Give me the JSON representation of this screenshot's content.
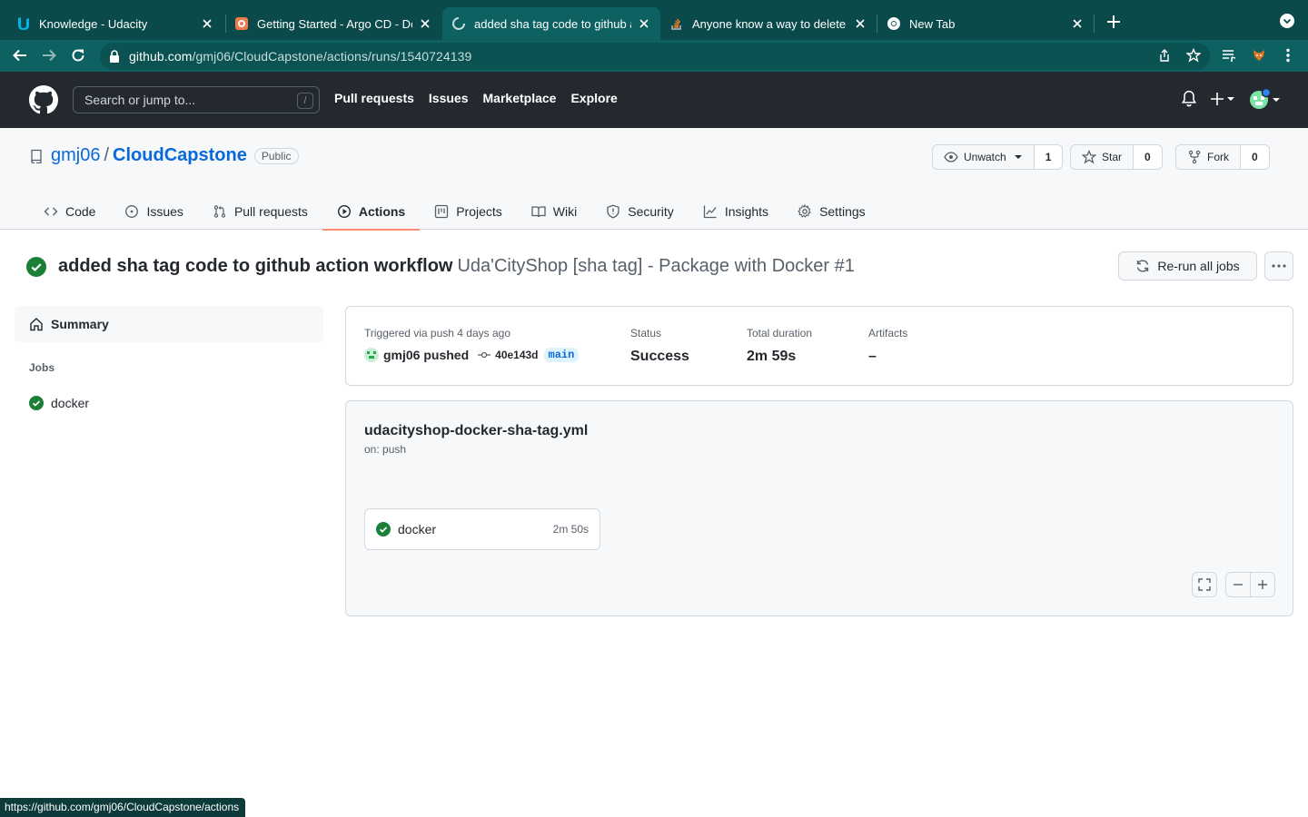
{
  "browser": {
    "tabs": [
      {
        "title": "Knowledge - Udacity",
        "favicon": "udacity-icon"
      },
      {
        "title": "Getting Started - Argo CD - Declarative GitOps CD for Kubernetes",
        "favicon": "argo-icon"
      },
      {
        "title": "added sha tag code to github action workflow",
        "favicon": "github-icon",
        "active": true
      },
      {
        "title": "Anyone know a way to delete a workflow from GitHub Actions?",
        "favicon": "stackoverflow-icon"
      },
      {
        "title": "New Tab",
        "favicon": "chrome-icon"
      }
    ],
    "url_host": "github.com",
    "url_path": "/gmj06/CloudCapstone/actions/runs/1540724139",
    "status_url": "https://github.com/gmj06/CloudCapstone/actions"
  },
  "gh_header": {
    "search_placeholder": "Search or jump to...",
    "search_shortcut": "/",
    "nav": [
      "Pull requests",
      "Issues",
      "Marketplace",
      "Explore"
    ]
  },
  "repo": {
    "owner": "gmj06",
    "separator": "/",
    "name": "CloudCapstone",
    "visibility": "Public",
    "watch_label": "Unwatch",
    "watch_count": "1",
    "star_label": "Star",
    "star_count": "0",
    "fork_label": "Fork",
    "fork_count": "0",
    "tabs": [
      {
        "label": "Code",
        "icon": "code-icon"
      },
      {
        "label": "Issues",
        "icon": "issue-icon"
      },
      {
        "label": "Pull requests",
        "icon": "pull-request-icon"
      },
      {
        "label": "Actions",
        "icon": "play-icon",
        "selected": true
      },
      {
        "label": "Projects",
        "icon": "project-icon"
      },
      {
        "label": "Wiki",
        "icon": "book-icon"
      },
      {
        "label": "Security",
        "icon": "shield-icon"
      },
      {
        "label": "Insights",
        "icon": "graph-icon"
      },
      {
        "label": "Settings",
        "icon": "gear-icon"
      }
    ]
  },
  "run": {
    "commit_message": "added sha tag code to github action workflow",
    "workflow_name": "Uda'CityShop [sha tag] - Package with Docker #1",
    "rerun_label": "Re-run all jobs"
  },
  "sidebar": {
    "summary_label": "Summary",
    "jobs_heading": "Jobs",
    "jobs": [
      {
        "name": "docker",
        "status": "success"
      }
    ]
  },
  "summary": {
    "trigger_label": "Triggered via push 4 days ago",
    "pusher": "gmj06 pushed",
    "sha": "40e143d",
    "branch": "main",
    "status_label": "Status",
    "status_value": "Success",
    "duration_label": "Total duration",
    "duration_value": "2m 59s",
    "artifacts_label": "Artifacts",
    "artifacts_value": "–"
  },
  "graph": {
    "workflow_file": "udacityshop-docker-sha-tag.yml",
    "trigger": "on: push",
    "job_name": "docker",
    "job_duration": "2m 50s"
  },
  "colors": {
    "success": "#1a7f37",
    "link": "#0969da",
    "header_bg": "#24292f",
    "tab_underline": "#fd8c73",
    "chrome_bg": "#0a4a4a"
  }
}
